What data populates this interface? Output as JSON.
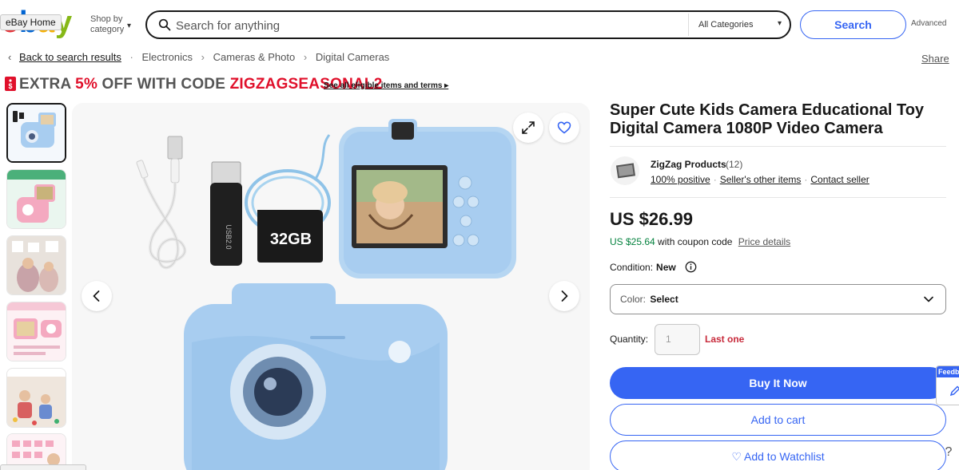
{
  "header": {
    "logo_tooltip": "eBay Home",
    "shop_by_category": [
      "Shop by",
      "category"
    ],
    "search_placeholder": "Search for anything",
    "category_select": "All Categories",
    "search_button": "Search",
    "advanced_link": "Advanced"
  },
  "breadcrumb": {
    "back": "Back to search results",
    "items": [
      "Electronics",
      "Cameras & Photo",
      "Digital Cameras"
    ],
    "share": "Share"
  },
  "promo": {
    "prefix": "EXTRA ",
    "percent": "5% ",
    "middle": "OFF WITH CODE ",
    "code": "ZIGZAGSEASONAL2",
    "link": "See all eligible items and terms ▸"
  },
  "product": {
    "title": "Super Cute Kids Camera Educational Toy Digital Camera 1080P Video Camera",
    "seller": {
      "name": "ZigZag Products",
      "count": "(12)",
      "feedback": "100% positive",
      "other_items": "Seller's other items",
      "contact": "Contact seller"
    },
    "price": "US $26.99",
    "coupon_price": "US $25.64",
    "coupon_text": " with coupon code",
    "price_details": "Price details",
    "condition_label": "Condition:",
    "condition_value": "New",
    "color_label": "Color:",
    "color_value": "Select",
    "quantity_label": "Quantity:",
    "quantity_placeholder": "1",
    "stock_note": "Last one",
    "buy_now": "Buy It Now",
    "add_to_cart": "Add to cart",
    "add_to_watchlist": "♡ Add to Watchlist"
  },
  "image": {
    "memory_card": "32GB",
    "card_reader": "USB2.0"
  },
  "feedback_tab": "Feedback",
  "colors": {
    "accent": "#3665f3",
    "promo_red": "#e0102b",
    "coupon_green": "#05823f",
    "stock_red": "#c7293a",
    "camera_blue": "#a8cdf0"
  }
}
